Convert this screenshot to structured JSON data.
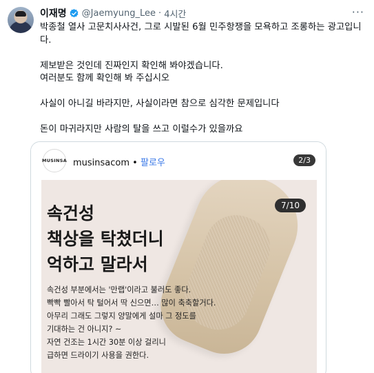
{
  "tweet": {
    "author_name": "이재명",
    "handle": "@Jaemyung_Lee",
    "separator": "·",
    "time": "4시간",
    "more_label": "···",
    "lines": [
      "박종철 열사 고문치사사건, 그로 시발된 6월 민주항쟁을 모욕하고 조롱하는 광고입니",
      "다.",
      "",
      "제보받은 것인데 진짜인지 확인해 봐야겠습니다.",
      "여러분도 함께 확인해 봐 주십시오",
      "",
      "사실이 아니길 바라지만, 사실이라면 참으로 심각한 문제입니다",
      "",
      "돈이 마귀라지만 사람의 탈을 쓰고 이럴수가 있을까요"
    ]
  },
  "media": {
    "brand_logo_text": "MUSINSA",
    "brand_name": "musinsacom",
    "dot": "•",
    "follow_label": "팔로우",
    "counter_top": "2/3",
    "counter_card": "7/10",
    "headline": [
      "속건성",
      "책상을 탁쳤더니",
      "억하고 말라서"
    ],
    "body": [
      "속건성 부분에서는 '만랩'이라고 불러도 좋다.",
      "빡빡 빨아서 탁 털어서 딱 신으면… 많이 축축할거다.",
      "아무리 그래도 그렇지 양말에게 설마 그 정도를",
      "기대하는 건 아니지? ~",
      "자연 건조는 1시간 30분 이상 걸리니",
      "급하면 드라이기 사용을 권한다."
    ]
  },
  "colors": {
    "verified": "#1d9bf0",
    "follow": "#3a78e7",
    "muted": "#536471",
    "card_bg": "#efe7e3"
  }
}
